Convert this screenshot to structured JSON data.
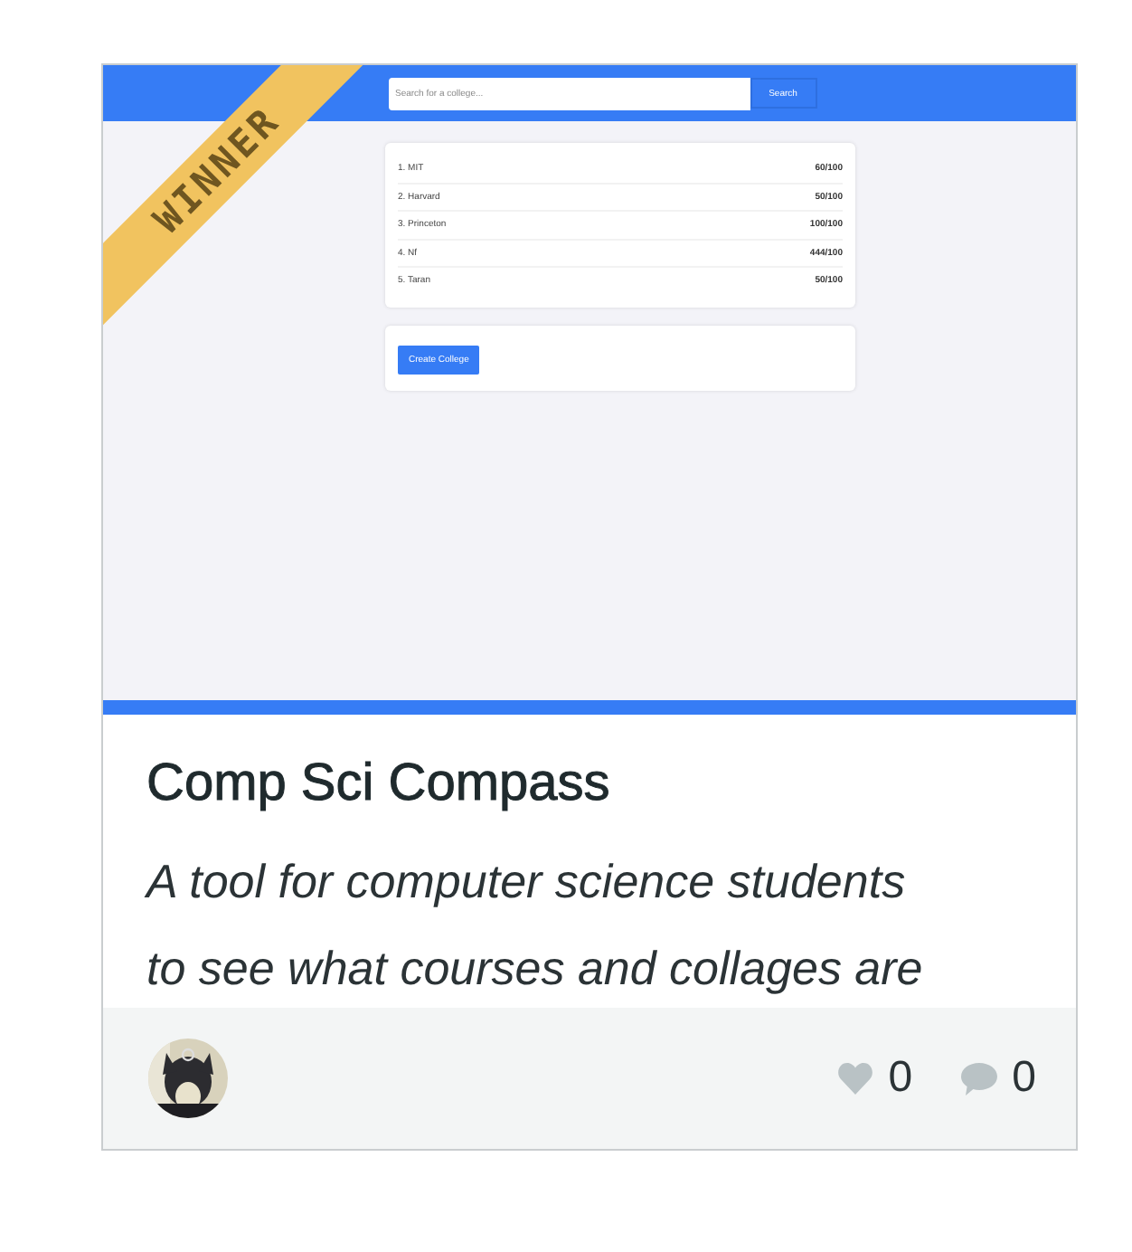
{
  "ribbon": {
    "label": "WINNER"
  },
  "preview": {
    "search": {
      "placeholder": "Search for a college...",
      "button": "Search"
    },
    "colleges": [
      {
        "name": "1. MIT",
        "score": "60/100"
      },
      {
        "name": "2. Harvard",
        "score": "50/100"
      },
      {
        "name": "3. Princeton",
        "score": "100/100"
      },
      {
        "name": "4. Nf",
        "score": "444/100"
      },
      {
        "name": "5. Taran",
        "score": "50/100"
      }
    ],
    "create_button": "Create College"
  },
  "project": {
    "title": "Comp Sci Compass",
    "description": "A tool for computer science students to see what courses and collages are"
  },
  "footer": {
    "likes": "0",
    "comments": "0"
  }
}
